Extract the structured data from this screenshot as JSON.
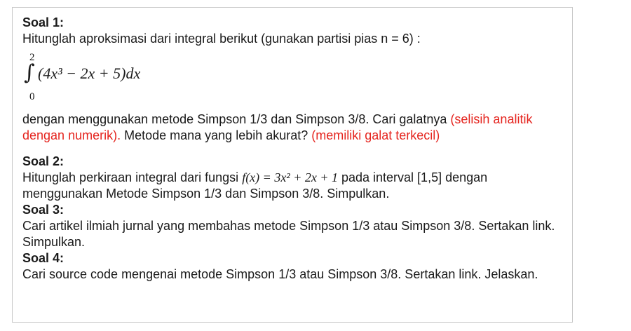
{
  "soal1": {
    "title": "Soal 1:",
    "prompt": "Hitunglah aproksimasi dari integral berikut (gunakan partisi pias n = 6) :",
    "integral": {
      "upper": "2",
      "lower": "0",
      "expression": "(4x³ − 2x + 5)dx"
    },
    "body_1": "dengan menggunakan metode Simpson 1/3 dan Simpson 3/8. Cari galatnya ",
    "body_red_1": "(selisih analitik dengan numerik).",
    "body_2": " Metode mana yang lebih akurat? ",
    "body_red_2": "(memiliki galat terkecil)"
  },
  "soal2": {
    "title": "Soal 2:",
    "text_before": "Hitunglah perkiraan integral dari fungsi ",
    "function": "f(x) = 3x² + 2x + 1",
    "text_after": " pada interval [1,5] dengan menggunakan Metode Simpson 1/3 dan Simpson 3/8. Simpulkan."
  },
  "soal3": {
    "title": "Soal 3:",
    "text": "Cari artikel ilmiah jurnal yang membahas metode Simpson 1/3 atau Simpson 3/8. Sertakan link. Simpulkan."
  },
  "soal4": {
    "title": "Soal 4:",
    "text": "Cari source code mengenai metode Simpson 1/3 atau Simpson 3/8. Sertakan link. Jelaskan."
  },
  "colors": {
    "emphasis": "#e5251f",
    "text": "#1a1a1a",
    "border": "#c8c8c8"
  }
}
